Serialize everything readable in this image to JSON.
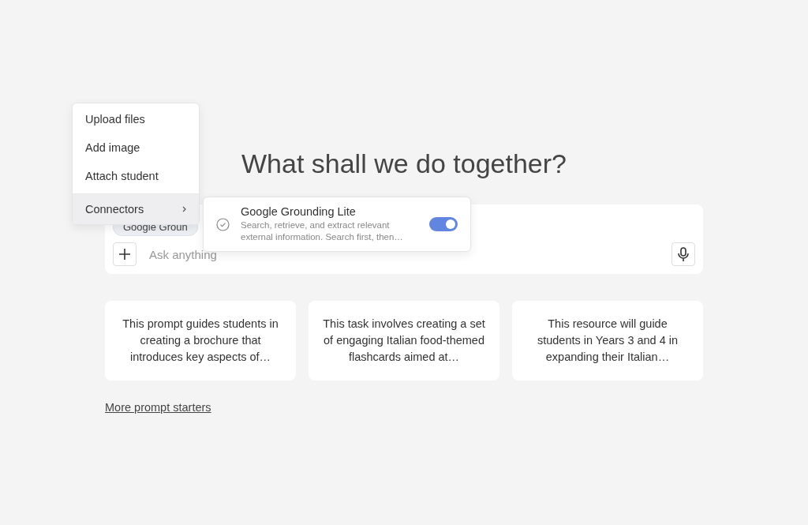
{
  "heading": "What shall we do together?",
  "composer": {
    "chips": [
      "Google Groun"
    ],
    "placeholder": "Ask anything"
  },
  "prompt_starters": [
    "This prompt guides students in creating a brochure that introduces key aspects of…",
    "This task involves creating a set of engaging Italian food-themed flashcards aimed at…",
    "This resource will guide students in Years 3 and 4 in expanding their Italian…"
  ],
  "more_link": "More prompt starters",
  "menu": {
    "items": [
      {
        "label": "Upload files",
        "kind": "action",
        "selected": false
      },
      {
        "label": "Add image",
        "kind": "action",
        "selected": false
      },
      {
        "label": "Attach student",
        "kind": "action",
        "selected": false
      },
      {
        "label": "Connectors",
        "kind": "submenu",
        "selected": true
      }
    ]
  },
  "submenu": {
    "items": [
      {
        "title": "Google Grounding Lite",
        "description": "Search, retrieve, and extract relevant external information. Search first, then…",
        "on": true
      }
    ]
  }
}
